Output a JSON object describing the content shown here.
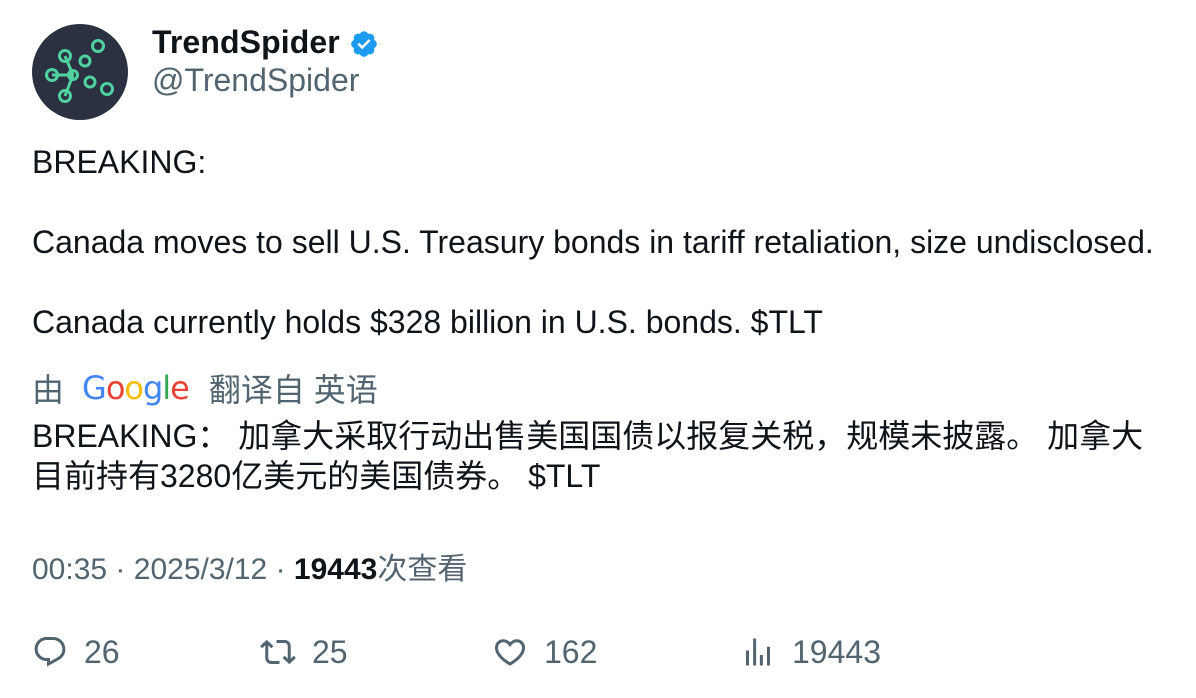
{
  "author": {
    "display_name": "TrendSpider",
    "handle": "@TrendSpider",
    "verified": true,
    "verified_color": "#1d9bf0",
    "avatar_icon": "network-nodes-icon",
    "avatar_bg": "#2b3140",
    "avatar_accent": "#4fd1a0"
  },
  "tweet": {
    "lines": [
      "BREAKING:",
      "Canada moves to sell U.S. Treasury bonds in tariff retaliation, size undisclosed.",
      "Canada currently holds $328 billion in U.S. bonds.  $TLT"
    ]
  },
  "translation": {
    "prefix": "由",
    "provider_letters": [
      "G",
      "o",
      "o",
      "g",
      "l",
      "e"
    ],
    "provider_colors": [
      "#4285f4",
      "#ea4335",
      "#fbbc05",
      "#4285f4",
      "#34a853",
      "#ea4335"
    ],
    "suffix": "翻译自 英语",
    "text": "BREAKING： 加拿大采取行动出售美国国债以报复关税，规模未披露。 加拿大目前持有3280亿美元的美国债券。 $TLT"
  },
  "meta": {
    "time": "00:35",
    "separator": "·",
    "date": "2025/3/12",
    "views_count": "19443",
    "views_label": "次查看"
  },
  "actions": {
    "replies": "26",
    "retweets": "25",
    "likes": "162",
    "views": "19443"
  },
  "colors": {
    "text_primary": "#0f1419",
    "text_secondary": "#536471"
  }
}
